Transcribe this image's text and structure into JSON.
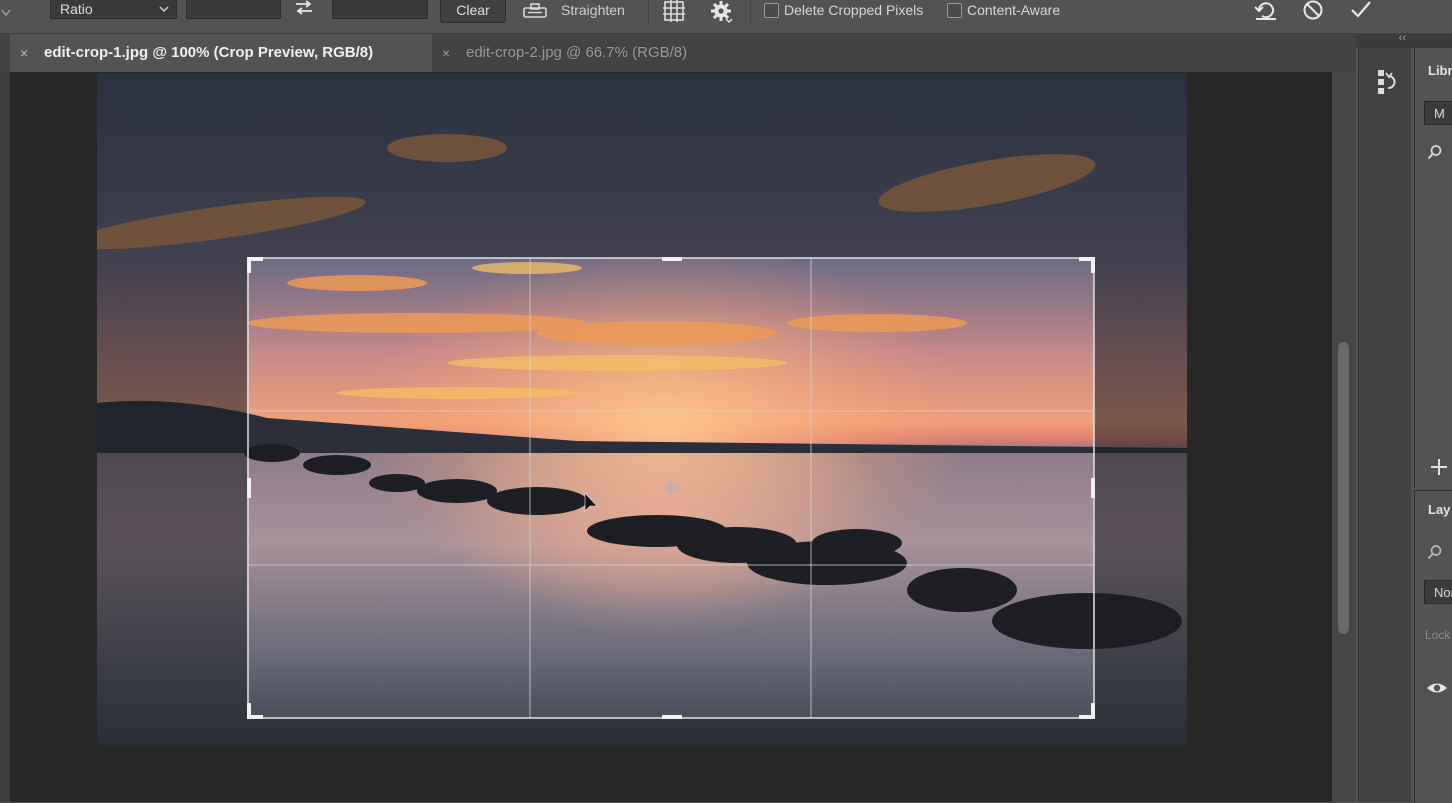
{
  "options_bar": {
    "ratio_label": "Ratio",
    "width_value": "",
    "height_value": "",
    "clear_label": "Clear",
    "straighten_label": "Straighten",
    "delete_cropped_label": "Delete Cropped Pixels",
    "delete_cropped_checked": false,
    "content_aware_label": "Content-Aware",
    "content_aware_checked": false
  },
  "tabs": [
    {
      "close": "×",
      "label": "edit-crop-1.jpg @ 100% (Crop Preview, RGB/8)",
      "active": true
    },
    {
      "close": "×",
      "label": "edit-crop-2.jpg @ 66.7% (RGB/8)",
      "active": false
    }
  ],
  "dock": {
    "collapse_label": "‹‹"
  },
  "libraries_panel": {
    "title": "Libr",
    "dropdown_value": "M"
  },
  "layers_panel": {
    "title": "Lay",
    "blend_mode_value": "Nor",
    "lock_label": "Lock"
  },
  "colors": {
    "accent": "#e8834a",
    "ui_bg": "#535353",
    "canvas_bg": "#282828"
  }
}
